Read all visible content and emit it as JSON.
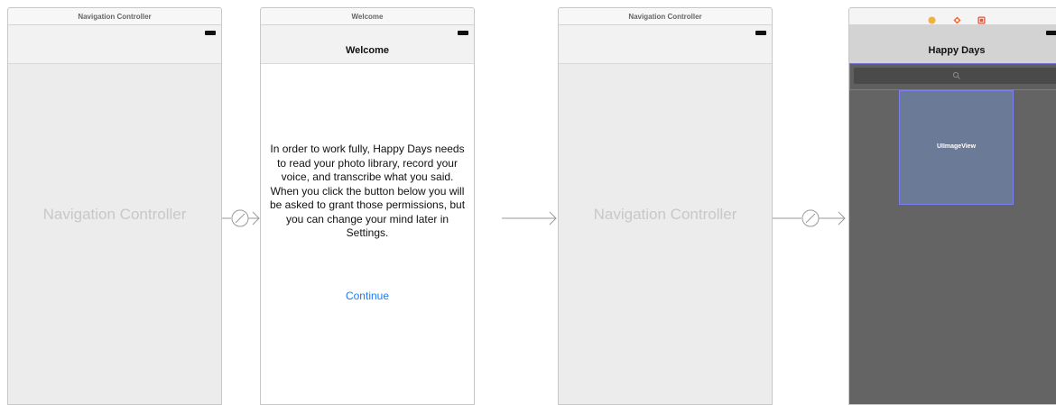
{
  "scenes": [
    {
      "title": "Navigation Controller",
      "placeholder": "Navigation Controller"
    },
    {
      "title": "Welcome",
      "nav_title": "Welcome",
      "body_text": "In order to work fully, Happy Days needs to read your photo library, record your voice, and transcribe what you said. When you click the button below you will be asked to grant those permissions, but you can change your mind later in Settings.",
      "continue_label": "Continue"
    },
    {
      "title": "Navigation Controller",
      "placeholder": "Navigation Controller"
    },
    {
      "nav_title": "Happy Days",
      "image_view_label": "UIImageView"
    }
  ],
  "icons": {
    "segue": "segue-icon",
    "search": "search-icon",
    "view_controller": "view-controller-icon",
    "first_responder": "first-responder-icon",
    "exit": "exit-icon"
  },
  "colors": {
    "link_blue": "#1a7cf5",
    "canvas_gray": "#ececec",
    "dark_view": "#646464",
    "image_view": "#6b7b97",
    "selection_outline": "#7273d6"
  }
}
